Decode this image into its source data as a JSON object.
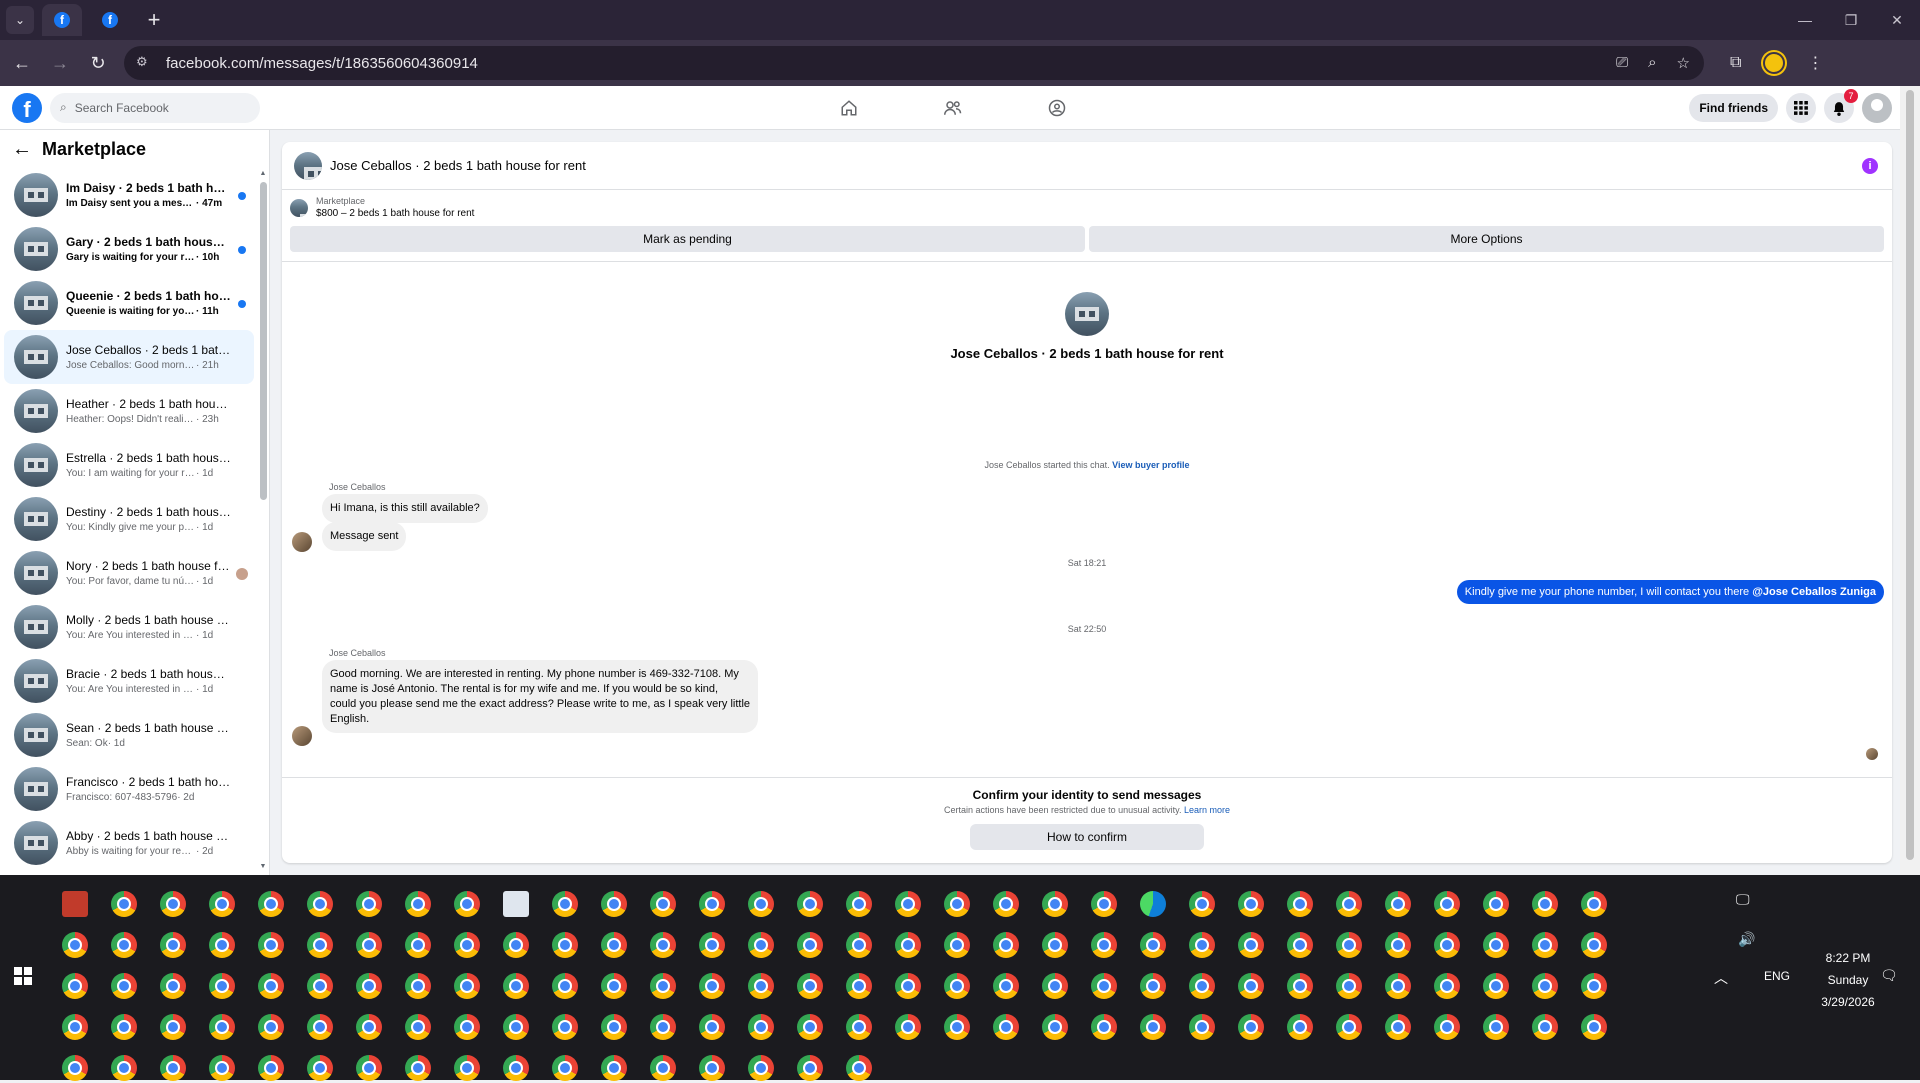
{
  "browser": {
    "url": "facebook.com/messages/t/1863560604360914",
    "new_tab": "+",
    "win_min": "—",
    "win_max": "❐",
    "win_close": "✕"
  },
  "fb": {
    "logo": "f",
    "search_placeholder": "Search Facebook",
    "find_friends": "Find friends",
    "notif_count": "7"
  },
  "sidebar": {
    "title": "Marketplace",
    "conversations": [
      {
        "title": "Im Daisy · 2 beds 1 bath hous...",
        "snippet": "Im Daisy sent you a message ...",
        "time": "· 47m",
        "unread": true
      },
      {
        "title": "Gary · 2 beds 1 bath house for...",
        "snippet": "Gary is waiting for your respo...",
        "time": "· 10h",
        "unread": true
      },
      {
        "title": "Queenie · 2 beds 1 bath house...",
        "snippet": "Queenie is waiting for your re...",
        "time": "· 11h",
        "unread": true
      },
      {
        "title": "Jose Ceballos · 2 beds 1 bath ho...",
        "snippet": "Jose Ceballos: Good morning. We...",
        "time": "· 21h",
        "active": true
      },
      {
        "title": "Heather · 2 beds 1 bath house f...",
        "snippet": "Heather: Oops! Didn't realize this...",
        "time": "· 23h"
      },
      {
        "title": "Estrella · 2 beds 1 bath house fo...",
        "snippet": "You: I am waiting for your reply, pl...",
        "time": "· 1d"
      },
      {
        "title": "Destiny · 2 beds 1 bath house f...",
        "snippet": "You: Kindly give me your phone n...",
        "time": "· 1d"
      },
      {
        "title": "Nory · 2 beds 1 bath house fo...",
        "snippet": "You: Por favor, dame tu número...",
        "time": "· 1d",
        "read_avatar": true
      },
      {
        "title": "Molly · 2 beds 1 bath house for ...",
        "snippet": "You: Are You interested in renting ...",
        "time": "· 1d"
      },
      {
        "title": "Bracie · 2 beds 1 bath house for...",
        "snippet": "You: Are You interested in renting ...",
        "time": "· 1d"
      },
      {
        "title": "Sean · 2 beds 1 bath house for r...",
        "snippet": "Sean: Ok",
        "time": "· 1d"
      },
      {
        "title": "Francisco · 2 beds 1 bath house ...",
        "snippet": "Francisco: 607-483-5796",
        "time": "· 2d"
      },
      {
        "title": "Abby · 2 beds 1 bath house for ...",
        "snippet": "Abby is waiting for your response.",
        "time": "· 2d"
      }
    ]
  },
  "chat": {
    "header_title": "Jose Ceballos · 2 beds 1 bath house for rent",
    "listing_label": "Marketplace",
    "listing_desc": "$800 – 2 beds 1 bath house for rent",
    "mark_pending": "Mark as pending",
    "more_options": "More Options",
    "hero_name": "Jose Ceballos · 2 beds 1 bath house for rent",
    "started_text": "Jose Ceballos started this chat.",
    "view_profile": "View buyer profile",
    "sender_name": "Jose Ceballos",
    "msg1": "Hi Imana, is this still available?",
    "msg2": "Message sent",
    "time1": "Sat 18:21",
    "out_msg": "Kindly give me your phone number, I will contact you there",
    "out_mention": "@Jose Ceballos Zuniga",
    "time2": "Sat 22:50",
    "msg3_lines": [
      "Good morning. We are interested in renting. My phone number is 469-332-7108. My",
      "name is José Antonio. The rental is for my wife and me. If you would be so kind,",
      "could you please send me the exact address? Please write to me, as I speak very little",
      "English."
    ],
    "confirm_title": "Confirm your identity to send messages",
    "confirm_sub": "Certain actions have been restricted due to unusual activity.",
    "learn_more": "Learn more",
    "how_to_confirm": "How to confirm"
  },
  "taskbar": {
    "lang": "ENG",
    "time": "8:22 PM",
    "day": "Sunday",
    "date": "3/29/2026"
  },
  "colors": {
    "fb_blue": "#1877f2",
    "out_bubble": "#0a55e6",
    "unread_dot": "#1877f2",
    "active_row": "#ebf5ff"
  }
}
